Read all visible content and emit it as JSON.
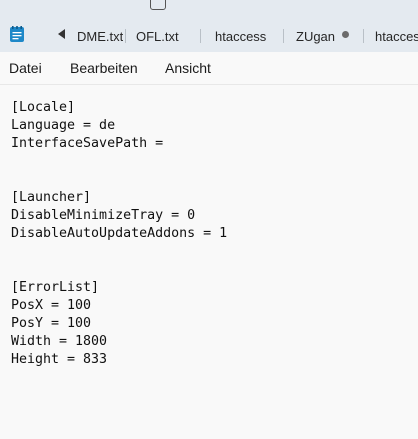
{
  "tabs": {
    "tab1": "DME.txt",
    "tab2": "OFL.txt",
    "tab3": "htaccess",
    "tab4": "ZUgan",
    "tab5": "htaccess"
  },
  "menu": {
    "file": "Datei",
    "edit": "Bearbeiten",
    "view": "Ansicht"
  },
  "editor": {
    "lines": [
      "[Locale]",
      "Language = de",
      "InterfaceSavePath =",
      "",
      "",
      "[Launcher]",
      "DisableMinimizeTray = 0",
      "DisableAutoUpdateAddons = 1",
      "",
      "",
      "[ErrorList]",
      "PosX = 100",
      "PosY = 100",
      "Width = 1800",
      "Height = 833"
    ]
  },
  "icons": {
    "app": "notepad-icon",
    "scroll_left": "caret-left-icon",
    "modified": "unsaved-dot-icon"
  },
  "colors": {
    "tabstrip_bg": "#e4eaf0",
    "editor_bg": "#f9f9f9",
    "app_icon": "#1e88c8"
  }
}
